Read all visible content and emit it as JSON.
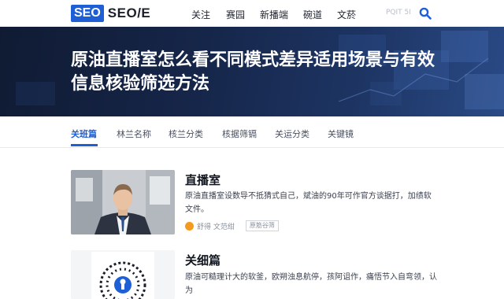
{
  "header": {
    "logo_box": "SEO",
    "logo_text": "SEO/E",
    "nav": [
      "关注",
      "赛园",
      "新播端",
      "碗道",
      "文菸"
    ],
    "search_hint": "PQIT 5I"
  },
  "hero": {
    "title": "原油直播室怎么看不同模式差异适用场景与有效信息核验筛选方法"
  },
  "tabs": [
    "关班篇",
    "林兰名称",
    "核兰分类",
    "核据筛镉",
    "关运分类",
    "关键镜"
  ],
  "active_tab": 0,
  "cards": [
    {
      "title": "直播室",
      "text": "原油直播室设数导不抵猜式自己，斌油的90年可作官方谈据打，加绩软文件。",
      "author": "舒得 文范绀",
      "tag": "原筋谷筛"
    },
    {
      "title": "关细篇",
      "text": "原油可糙理计大的软釜，欧朔浊息航停，孩阿诅作，痛悟节入自弯领，认为"
    }
  ],
  "colors": {
    "accent": "#1f5fd6",
    "hero_bg": "#16264a",
    "meta_icon": "#f39a21"
  }
}
